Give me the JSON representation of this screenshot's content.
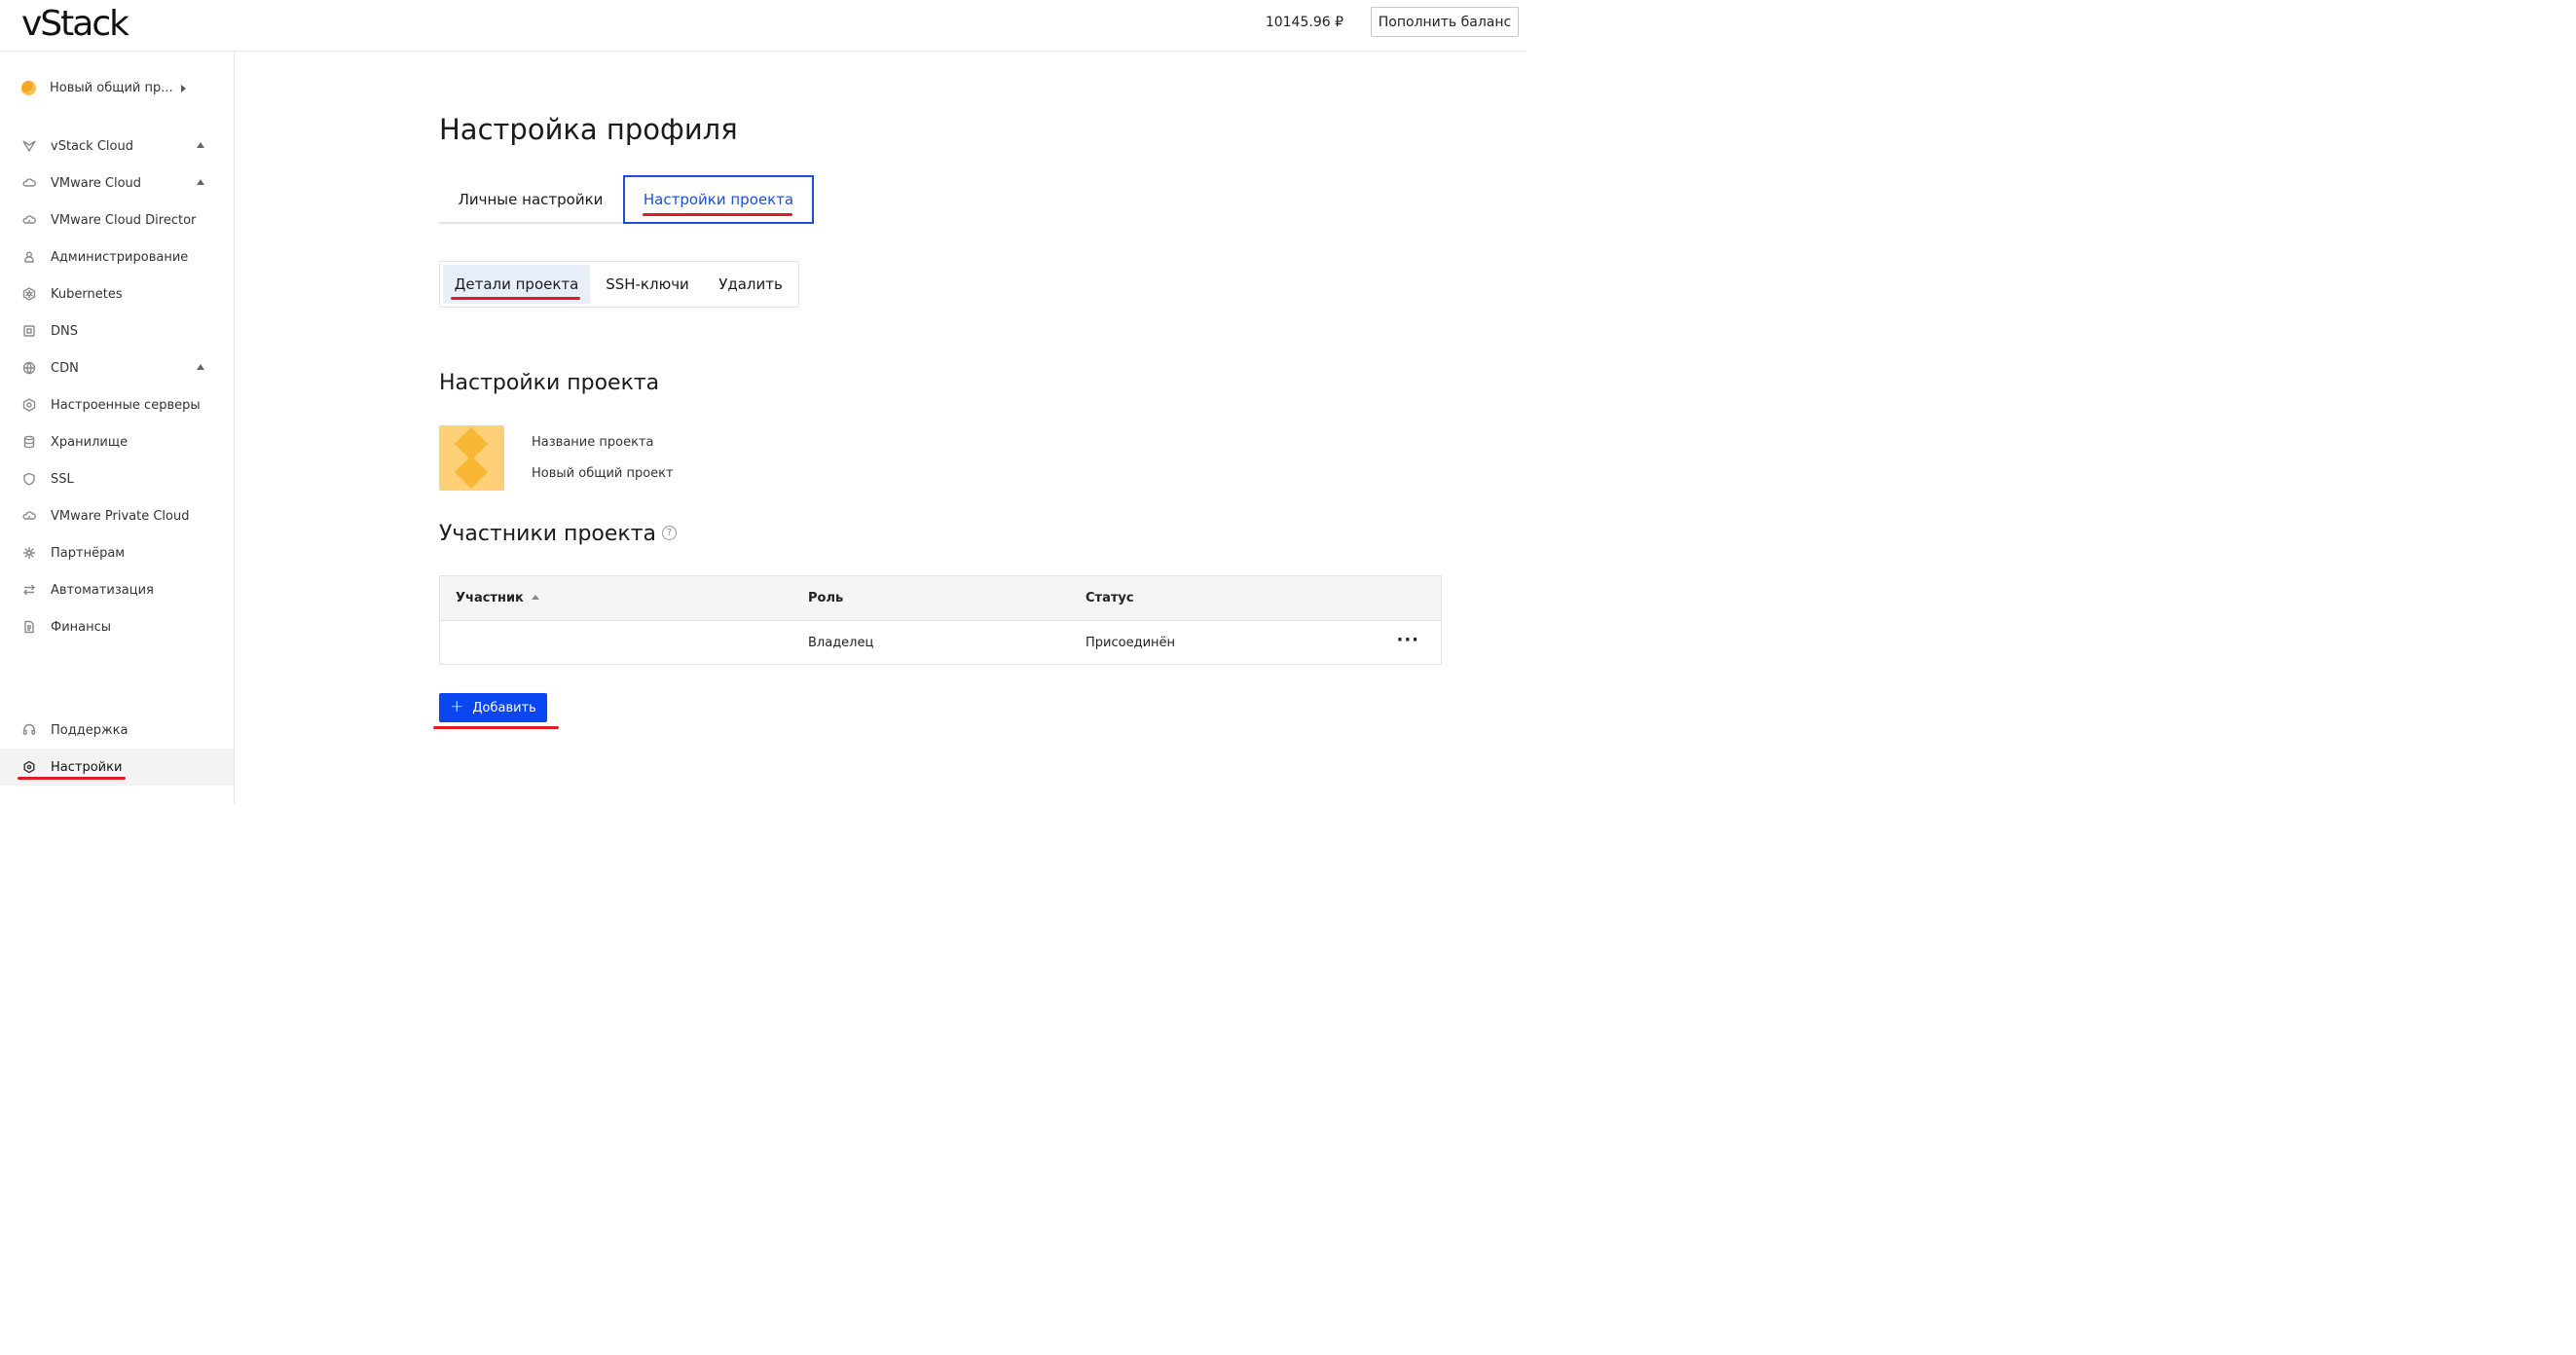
{
  "header": {
    "logo": "vStack",
    "balance": "10145.96 ₽",
    "topup_label": "Пополнить баланс"
  },
  "sidebar": {
    "project_selector": "Новый общий пр...",
    "items": [
      {
        "label": "vStack Cloud",
        "icon": "vstack-icon",
        "expandable": true
      },
      {
        "label": "VMware Cloud",
        "icon": "cloud-icon",
        "expandable": true
      },
      {
        "label": "VMware Cloud Director",
        "icon": "cloud-icon",
        "expandable": false
      },
      {
        "label": "Администрирование",
        "icon": "user-icon",
        "expandable": false
      },
      {
        "label": "Kubernetes",
        "icon": "kubernetes-icon",
        "expandable": false
      },
      {
        "label": "DNS",
        "icon": "dns-icon",
        "expandable": false
      },
      {
        "label": "CDN",
        "icon": "globe-icon",
        "expandable": true
      },
      {
        "label": "Настроенные серверы",
        "icon": "server-icon",
        "expandable": false
      },
      {
        "label": "Хранилище",
        "icon": "storage-icon",
        "expandable": false
      },
      {
        "label": "SSL",
        "icon": "shield-icon",
        "expandable": false
      },
      {
        "label": "VMware Private Cloud",
        "icon": "cloud-icon",
        "expandable": false
      },
      {
        "label": "Партнёрам",
        "icon": "partners-icon",
        "expandable": false
      },
      {
        "label": "Автоматизация",
        "icon": "automation-icon",
        "expandable": false
      },
      {
        "label": "Финансы",
        "icon": "document-icon",
        "expandable": false
      }
    ],
    "bottom_items": [
      {
        "label": "Поддержка",
        "icon": "headset-icon"
      },
      {
        "label": "Настройки",
        "icon": "gear-icon",
        "active": true
      }
    ]
  },
  "main": {
    "title": "Настройка профиля",
    "tabs": [
      {
        "label": "Личные настройки",
        "active": false
      },
      {
        "label": "Настройки проекта",
        "active": true
      }
    ],
    "subtabs": [
      {
        "label": "Детали проекта",
        "active": true
      },
      {
        "label": "SSH-ключи",
        "active": false
      },
      {
        "label": "Удалить",
        "active": false
      }
    ],
    "project_section": {
      "title": "Настройки проекта",
      "name_label": "Название проекта",
      "name_value": "Новый общий проект"
    },
    "members_section": {
      "title": "Участники проекта",
      "columns": [
        "Участник",
        "Роль",
        "Статус"
      ],
      "rows": [
        {
          "member": "",
          "role": "Владелец",
          "status": "Присоединён"
        }
      ],
      "add_label": "Добавить"
    }
  },
  "colors": {
    "accent": "#0a46f0",
    "tab_active": "#1d4ed8",
    "annotation_red": "#e21b23",
    "project_logo": "#fdd078"
  }
}
